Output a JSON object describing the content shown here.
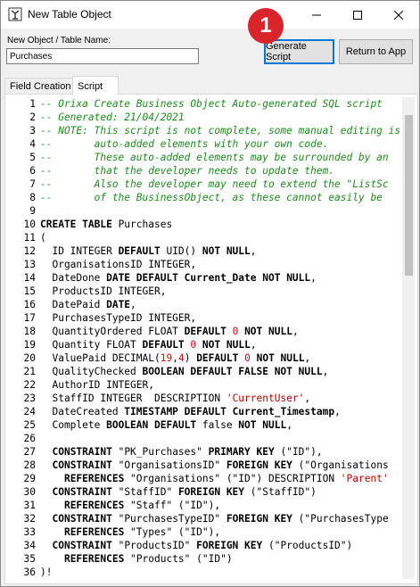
{
  "window": {
    "title": "New Table Object",
    "icon": "app-icon"
  },
  "form": {
    "label": "New Object / Table Name:",
    "table_name": "Purchases",
    "generate_label": "Generate Script",
    "return_label": "Return to App",
    "step_badge": "1"
  },
  "tabs": [
    {
      "label": "Field Creation",
      "selected": false
    },
    {
      "label": "Script",
      "selected": true
    }
  ],
  "colors": {
    "comment": "#1e8c1e",
    "number": "#e00000",
    "string": "#c00000",
    "badge": "#d9252a",
    "focus": "#0078d7"
  },
  "script": [
    {
      "n": "1",
      "segs": [
        {
          "t": "-- Orixa Create Business Object Auto-generated SQL script",
          "c": "cm"
        }
      ]
    },
    {
      "n": "2",
      "segs": [
        {
          "t": "-- Generated: 21/04/2021",
          "c": "cm"
        }
      ]
    },
    {
      "n": "3",
      "segs": [
        {
          "t": "-- NOTE: This script is not complete, some manual editing is",
          "c": "cm"
        }
      ]
    },
    {
      "n": "4",
      "segs": [
        {
          "t": "--       auto-added elements with your own code.",
          "c": "cm"
        }
      ]
    },
    {
      "n": "5",
      "segs": [
        {
          "t": "--       These auto-added elements may be surrounded by an",
          "c": "cm"
        }
      ]
    },
    {
      "n": "6",
      "segs": [
        {
          "t": "--       that the developer needs to update them.",
          "c": "cm"
        }
      ]
    },
    {
      "n": "7",
      "segs": [
        {
          "t": "--       Also the developer may need to extend the \"ListSc",
          "c": "cm"
        }
      ]
    },
    {
      "n": "8",
      "segs": [
        {
          "t": "--       of the BusinessObject, as these cannot easily be",
          "c": "cm"
        }
      ]
    },
    {
      "n": "9",
      "segs": []
    },
    {
      "n": "10",
      "segs": [
        {
          "t": "CREATE TABLE",
          "c": "kw"
        },
        {
          "t": " Purchases",
          "c": ""
        }
      ]
    },
    {
      "n": "11",
      "segs": [
        {
          "t": "(",
          "c": ""
        }
      ]
    },
    {
      "n": "12",
      "segs": [
        {
          "t": "  ID INTEGER ",
          "c": ""
        },
        {
          "t": "DEFAULT",
          "c": "kw"
        },
        {
          "t": " UID() ",
          "c": ""
        },
        {
          "t": "NOT NULL",
          "c": "kw"
        },
        {
          "t": ",",
          "c": ""
        }
      ]
    },
    {
      "n": "13",
      "segs": [
        {
          "t": "  OrganisationsID INTEGER,",
          "c": ""
        }
      ]
    },
    {
      "n": "14",
      "segs": [
        {
          "t": "  DateDone ",
          "c": ""
        },
        {
          "t": "DATE DEFAULT",
          "c": "kw"
        },
        {
          "t": " ",
          "c": ""
        },
        {
          "t": "Current_Date",
          "c": "kw"
        },
        {
          "t": " ",
          "c": ""
        },
        {
          "t": "NOT NULL",
          "c": "kw"
        },
        {
          "t": ",",
          "c": ""
        }
      ]
    },
    {
      "n": "15",
      "segs": [
        {
          "t": "  ProductsID INTEGER,",
          "c": ""
        }
      ]
    },
    {
      "n": "16",
      "segs": [
        {
          "t": "  DatePaid ",
          "c": ""
        },
        {
          "t": "DATE",
          "c": "kw"
        },
        {
          "t": ",",
          "c": ""
        }
      ]
    },
    {
      "n": "17",
      "segs": [
        {
          "t": "  PurchasesTypeID INTEGER,",
          "c": ""
        }
      ]
    },
    {
      "n": "18",
      "segs": [
        {
          "t": "  QuantityOrdered FLOAT ",
          "c": ""
        },
        {
          "t": "DEFAULT",
          "c": "kw"
        },
        {
          "t": " ",
          "c": ""
        },
        {
          "t": "0",
          "c": "num"
        },
        {
          "t": " ",
          "c": ""
        },
        {
          "t": "NOT NULL",
          "c": "kw"
        },
        {
          "t": ",",
          "c": ""
        }
      ]
    },
    {
      "n": "19",
      "segs": [
        {
          "t": "  Quantity FLOAT ",
          "c": ""
        },
        {
          "t": "DEFAULT",
          "c": "kw"
        },
        {
          "t": " ",
          "c": ""
        },
        {
          "t": "0",
          "c": "num"
        },
        {
          "t": " ",
          "c": ""
        },
        {
          "t": "NOT NULL",
          "c": "kw"
        },
        {
          "t": ",",
          "c": ""
        }
      ]
    },
    {
      "n": "20",
      "segs": [
        {
          "t": "  ValuePaid DECIMAL(",
          "c": ""
        },
        {
          "t": "19",
          "c": "num"
        },
        {
          "t": ",",
          "c": ""
        },
        {
          "t": "4",
          "c": "num"
        },
        {
          "t": ") ",
          "c": ""
        },
        {
          "t": "DEFAULT",
          "c": "kw"
        },
        {
          "t": " ",
          "c": ""
        },
        {
          "t": "0",
          "c": "num"
        },
        {
          "t": " ",
          "c": ""
        },
        {
          "t": "NOT NULL",
          "c": "kw"
        },
        {
          "t": ",",
          "c": ""
        }
      ]
    },
    {
      "n": "21",
      "segs": [
        {
          "t": "  QualityChecked ",
          "c": ""
        },
        {
          "t": "BOOLEAN DEFAULT FALSE NOT NULL",
          "c": "kw"
        },
        {
          "t": ",",
          "c": ""
        }
      ]
    },
    {
      "n": "22",
      "segs": [
        {
          "t": "  AuthorID INTEGER,",
          "c": ""
        }
      ]
    },
    {
      "n": "23",
      "segs": [
        {
          "t": "  StaffID INTEGER  DESCRIPTION ",
          "c": ""
        },
        {
          "t": "'CurrentUser'",
          "c": "str"
        },
        {
          "t": ",",
          "c": ""
        }
      ]
    },
    {
      "n": "24",
      "segs": [
        {
          "t": "  DateCreated ",
          "c": ""
        },
        {
          "t": "TIMESTAMP DEFAULT",
          "c": "kw"
        },
        {
          "t": " ",
          "c": ""
        },
        {
          "t": "Current_Timestamp",
          "c": "kw"
        },
        {
          "t": ",",
          "c": ""
        }
      ]
    },
    {
      "n": "25",
      "segs": [
        {
          "t": "  Complete ",
          "c": ""
        },
        {
          "t": "BOOLEAN DEFAULT",
          "c": "kw"
        },
        {
          "t": " false ",
          "c": ""
        },
        {
          "t": "NOT NULL",
          "c": "kw"
        },
        {
          "t": ",",
          "c": ""
        }
      ]
    },
    {
      "n": "26",
      "segs": []
    },
    {
      "n": "27",
      "segs": [
        {
          "t": "  ",
          "c": ""
        },
        {
          "t": "CONSTRAINT",
          "c": "kw"
        },
        {
          "t": " \"PK_Purchases\" ",
          "c": ""
        },
        {
          "t": "PRIMARY KEY",
          "c": "kw"
        },
        {
          "t": " (\"ID\"),",
          "c": ""
        }
      ]
    },
    {
      "n": "28",
      "segs": [
        {
          "t": "  ",
          "c": ""
        },
        {
          "t": "CONSTRAINT",
          "c": "kw"
        },
        {
          "t": " \"OrganisationsID\" ",
          "c": ""
        },
        {
          "t": "FOREIGN KEY",
          "c": "kw"
        },
        {
          "t": " (\"Organisations",
          "c": ""
        }
      ]
    },
    {
      "n": "29",
      "segs": [
        {
          "t": "    ",
          "c": ""
        },
        {
          "t": "REFERENCES",
          "c": "kw"
        },
        {
          "t": " \"Organisations\" (\"ID\") DESCRIPTION ",
          "c": ""
        },
        {
          "t": "'Parent'",
          "c": "str"
        }
      ]
    },
    {
      "n": "30",
      "segs": [
        {
          "t": "  ",
          "c": ""
        },
        {
          "t": "CONSTRAINT",
          "c": "kw"
        },
        {
          "t": " \"StaffID\" ",
          "c": ""
        },
        {
          "t": "FOREIGN KEY",
          "c": "kw"
        },
        {
          "t": " (\"StaffID\")",
          "c": ""
        }
      ]
    },
    {
      "n": "31",
      "segs": [
        {
          "t": "    ",
          "c": ""
        },
        {
          "t": "REFERENCES",
          "c": "kw"
        },
        {
          "t": " \"Staff\" (\"ID\"),",
          "c": ""
        }
      ]
    },
    {
      "n": "32",
      "segs": [
        {
          "t": "  ",
          "c": ""
        },
        {
          "t": "CONSTRAINT",
          "c": "kw"
        },
        {
          "t": " \"PurchasesTypeID\" ",
          "c": ""
        },
        {
          "t": "FOREIGN KEY",
          "c": "kw"
        },
        {
          "t": " (\"PurchasesType",
          "c": ""
        }
      ]
    },
    {
      "n": "33",
      "segs": [
        {
          "t": "    ",
          "c": ""
        },
        {
          "t": "REFERENCES",
          "c": "kw"
        },
        {
          "t": " \"Types\" (\"ID\"),",
          "c": ""
        }
      ]
    },
    {
      "n": "34",
      "segs": [
        {
          "t": "  ",
          "c": ""
        },
        {
          "t": "CONSTRAINT",
          "c": "kw"
        },
        {
          "t": " \"ProductsID\" ",
          "c": ""
        },
        {
          "t": "FOREIGN KEY",
          "c": "kw"
        },
        {
          "t": " (\"ProductsID\")",
          "c": ""
        }
      ]
    },
    {
      "n": "35",
      "segs": [
        {
          "t": "    ",
          "c": ""
        },
        {
          "t": "REFERENCES",
          "c": "kw"
        },
        {
          "t": " \"Products\" (\"ID\")",
          "c": ""
        }
      ]
    },
    {
      "n": "36",
      "segs": [
        {
          "t": ")!",
          "c": ""
        }
      ]
    }
  ]
}
